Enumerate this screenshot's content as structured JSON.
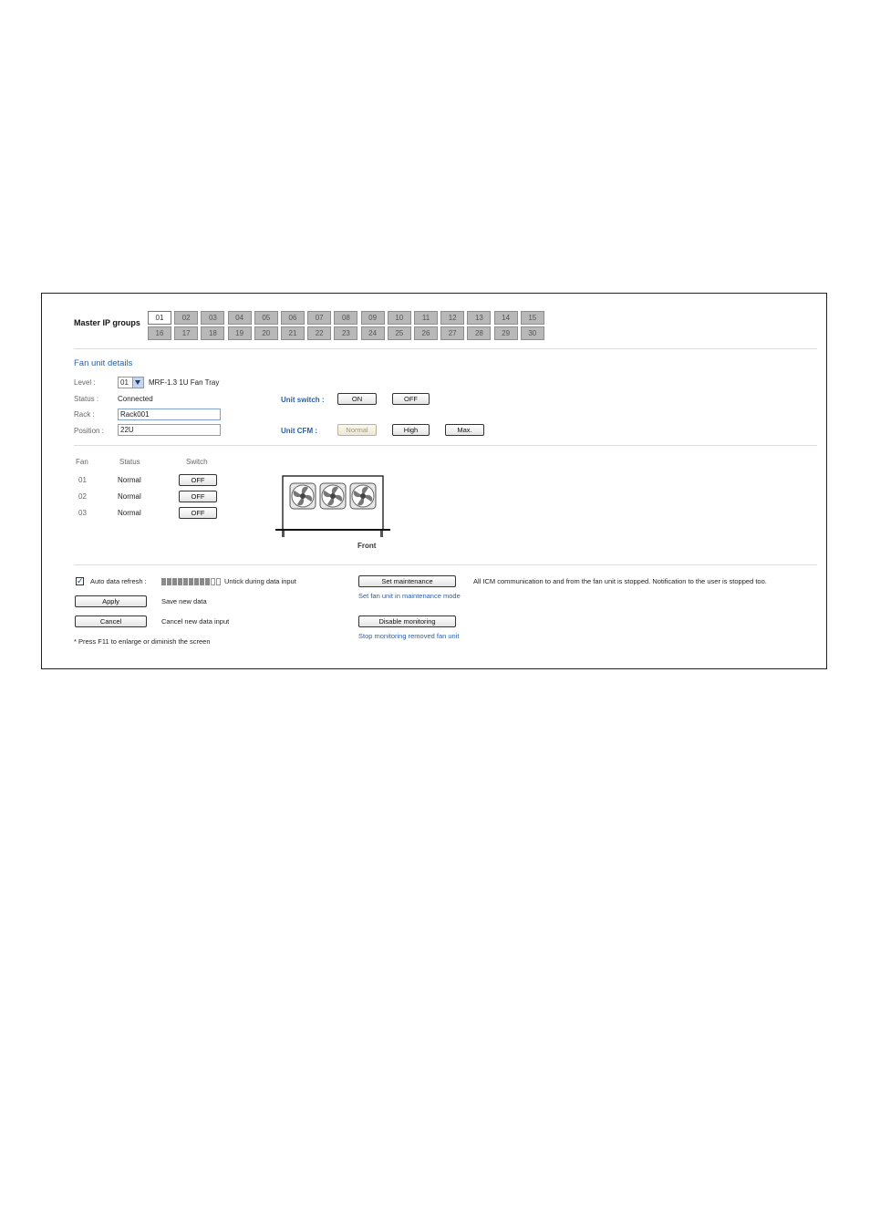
{
  "master_ip_groups": {
    "label": "Master IP groups",
    "groups": [
      "01",
      "02",
      "03",
      "04",
      "05",
      "06",
      "07",
      "08",
      "09",
      "10",
      "11",
      "12",
      "13",
      "14",
      "15",
      "16",
      "17",
      "18",
      "19",
      "20",
      "21",
      "22",
      "23",
      "24",
      "25",
      "26",
      "27",
      "28",
      "29",
      "30"
    ],
    "active": "01"
  },
  "fan_unit_details": {
    "title": "Fan unit details",
    "level_label": "Level :",
    "level_value": "01",
    "model": "MRF-1.3 1U Fan Tray",
    "status_label": "Status :",
    "status_value": "Connected",
    "rack_label": "Rack :",
    "rack_value": "Rack001",
    "position_label": "Position :",
    "position_value": "22U",
    "unit_switch_label": "Unit switch :",
    "unit_switch_on": "ON",
    "unit_switch_off": "OFF",
    "unit_cfm_label": "Unit CFM :",
    "cfm_normal": "Normal",
    "cfm_high": "High",
    "cfm_max": "Max."
  },
  "fan_table": {
    "headers": [
      "Fan",
      "Status",
      "Switch"
    ],
    "rows": [
      {
        "fan": "01",
        "status": "Normal",
        "switch": "OFF"
      },
      {
        "fan": "02",
        "status": "Normal",
        "switch": "OFF"
      },
      {
        "fan": "03",
        "status": "Normal",
        "switch": "OFF"
      }
    ],
    "front_label": "Front"
  },
  "controls": {
    "auto_refresh_label": "Auto data refresh :",
    "auto_refresh_checked": true,
    "refresh_progress_segments_filled": 9,
    "refresh_progress_segments_total": 11,
    "untick_hint": "Untick during data input",
    "apply_label": "Apply",
    "apply_hint": "Save new data",
    "cancel_label": "Cancel",
    "cancel_hint": "Cancel new data input",
    "f11_note": "* Press F11 to enlarge or diminish the screen",
    "set_maintenance_label": "Set maintenance",
    "set_maintenance_link": "Set fan unit in maintenance mode",
    "maintenance_note": "All ICM communication to and from the fan unit is stopped. Notification to the user is stopped too.",
    "disable_monitoring_label": "Disable monitoring",
    "disable_monitoring_link": "Stop monitoring removed fan unit"
  },
  "colors": {
    "link_blue": "#2a5fa8",
    "group_inactive": "#b8b8b8",
    "input_border": "#7fa2cc"
  }
}
